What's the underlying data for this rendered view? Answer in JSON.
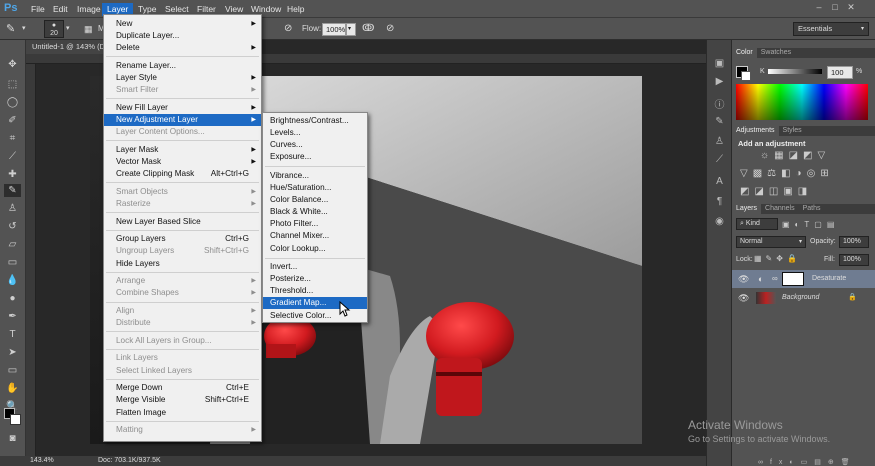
{
  "app": {
    "logo": "Ps"
  },
  "menubar": {
    "items": [
      "File",
      "Edit",
      "Image",
      "Layer",
      "Type",
      "Select",
      "Filter",
      "View",
      "Window",
      "Help"
    ],
    "active": "Layer",
    "window_controls": [
      "–",
      "□",
      "✕"
    ]
  },
  "options_bar": {
    "brush_size": "20",
    "mode_short": "M",
    "flow_label": "Flow:",
    "flow_value": "100%",
    "workspace": "Essentials"
  },
  "document": {
    "tab_title": "Untitled-1 @ 143% (D"
  },
  "status_bar": {
    "zoom": "143.4%",
    "doc_info": "Doc: 703.1K/937.5K"
  },
  "layer_menu": {
    "items": [
      {
        "label": "New",
        "arrow": true
      },
      {
        "label": "Duplicate Layer..."
      },
      {
        "label": "Delete",
        "arrow": true
      },
      {
        "sep": true
      },
      {
        "label": "Rename Layer..."
      },
      {
        "label": "Layer Style",
        "arrow": true
      },
      {
        "label": "Smart Filter",
        "disabled": true,
        "arrow": true
      },
      {
        "sep": true
      },
      {
        "label": "New Fill Layer",
        "arrow": true
      },
      {
        "label": "New Adjustment Layer",
        "arrow": true,
        "highlight": true
      },
      {
        "label": "Layer Content Options...",
        "disabled": true
      },
      {
        "sep": true
      },
      {
        "label": "Layer Mask",
        "arrow": true
      },
      {
        "label": "Vector Mask",
        "arrow": true
      },
      {
        "label": "Create Clipping Mask",
        "shortcut": "Alt+Ctrl+G"
      },
      {
        "sep": true
      },
      {
        "label": "Smart Objects",
        "disabled": true,
        "arrow": true
      },
      {
        "label": "Rasterize",
        "disabled": true,
        "arrow": true
      },
      {
        "sep": true
      },
      {
        "label": "New Layer Based Slice"
      },
      {
        "sep": true
      },
      {
        "label": "Group Layers",
        "shortcut": "Ctrl+G"
      },
      {
        "label": "Ungroup Layers",
        "disabled": true,
        "shortcut": "Shift+Ctrl+G"
      },
      {
        "label": "Hide Layers"
      },
      {
        "sep": true
      },
      {
        "label": "Arrange",
        "disabled": true,
        "arrow": true
      },
      {
        "label": "Combine Shapes",
        "disabled": true,
        "arrow": true
      },
      {
        "sep": true
      },
      {
        "label": "Align",
        "disabled": true,
        "arrow": true
      },
      {
        "label": "Distribute",
        "disabled": true,
        "arrow": true
      },
      {
        "sep": true
      },
      {
        "label": "Lock All Layers in Group...",
        "disabled": true
      },
      {
        "sep": true
      },
      {
        "label": "Link Layers",
        "disabled": true
      },
      {
        "label": "Select Linked Layers",
        "disabled": true
      },
      {
        "sep": true
      },
      {
        "label": "Merge Down",
        "shortcut": "Ctrl+E"
      },
      {
        "label": "Merge Visible",
        "shortcut": "Shift+Ctrl+E"
      },
      {
        "label": "Flatten Image"
      },
      {
        "sep": true
      },
      {
        "label": "Matting",
        "disabled": true,
        "arrow": true
      }
    ]
  },
  "adjustment_submenu": {
    "items": [
      {
        "label": "Brightness/Contrast..."
      },
      {
        "label": "Levels..."
      },
      {
        "label": "Curves..."
      },
      {
        "label": "Exposure..."
      },
      {
        "sep": true
      },
      {
        "label": "Vibrance..."
      },
      {
        "label": "Hue/Saturation..."
      },
      {
        "label": "Color Balance..."
      },
      {
        "label": "Black & White..."
      },
      {
        "label": "Photo Filter..."
      },
      {
        "label": "Channel Mixer..."
      },
      {
        "label": "Color Lookup..."
      },
      {
        "sep": true
      },
      {
        "label": "Invert..."
      },
      {
        "label": "Posterize..."
      },
      {
        "label": "Threshold..."
      },
      {
        "label": "Gradient Map...",
        "highlight": true
      },
      {
        "label": "Selective Color..."
      }
    ]
  },
  "color_panel": {
    "tabs": [
      "Color",
      "Swatches"
    ],
    "channel": "K",
    "value": "100",
    "unit": "%"
  },
  "adjustments_panel": {
    "tabs": [
      "Adjustments",
      "Styles"
    ],
    "heading": "Add an adjustment"
  },
  "layers_panel": {
    "tabs": [
      "Layers",
      "Channels",
      "Paths"
    ],
    "kind": "Kind",
    "blend_mode": "Normal",
    "opacity_label": "Opacity:",
    "opacity": "100%",
    "lock_label": "Lock:",
    "fill_label": "Fill:",
    "fill": "100%",
    "layers": [
      {
        "name": "Desaturate",
        "selected": true
      },
      {
        "name": "Background",
        "locked": true
      }
    ]
  },
  "watermark": {
    "line1": "Activate Windows",
    "line2": "Go to Settings to activate Windows."
  },
  "colors": {
    "accent": "#1d6ac4",
    "glove_red": "#d11a1f",
    "chrome": "#535353"
  }
}
